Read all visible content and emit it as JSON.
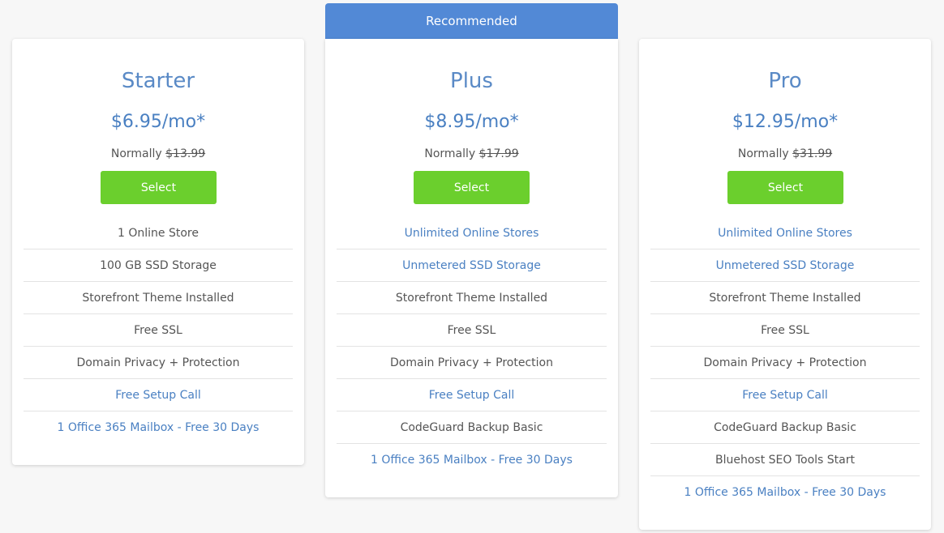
{
  "ribbon": {
    "label": "Recommended"
  },
  "colors": {
    "accent_blue": "#5289d6",
    "link_blue": "#4a80c2",
    "select_green": "#6bcf2d",
    "text_gray": "#555555"
  },
  "plans": [
    {
      "name": "Starter",
      "price": "$6.95/mo*",
      "normally_label": "Normally",
      "normally_price": "$13.99",
      "select_label": "Select",
      "features": [
        {
          "text": "1 Online Store",
          "highlight": false
        },
        {
          "text": "100 GB SSD Storage",
          "highlight": false
        },
        {
          "text": "Storefront Theme Installed",
          "highlight": false
        },
        {
          "text": "Free SSL",
          "highlight": false
        },
        {
          "text": "Domain Privacy + Protection",
          "highlight": false
        },
        {
          "text": "Free Setup Call",
          "highlight": true
        },
        {
          "text": "1 Office 365 Mailbox - Free 30 Days",
          "highlight": true
        }
      ]
    },
    {
      "name": "Plus",
      "price": "$8.95/mo*",
      "normally_label": "Normally",
      "normally_price": "$17.99",
      "select_label": "Select",
      "features": [
        {
          "text": "Unlimited Online Stores",
          "highlight": true
        },
        {
          "text": "Unmetered SSD Storage",
          "highlight": true
        },
        {
          "text": "Storefront Theme Installed",
          "highlight": false
        },
        {
          "text": "Free SSL",
          "highlight": false
        },
        {
          "text": "Domain Privacy + Protection",
          "highlight": false
        },
        {
          "text": "Free Setup Call",
          "highlight": true
        },
        {
          "text": "CodeGuard Backup Basic",
          "highlight": false
        },
        {
          "text": "1 Office 365 Mailbox - Free 30 Days",
          "highlight": true
        }
      ]
    },
    {
      "name": "Pro",
      "price": "$12.95/mo*",
      "normally_label": "Normally",
      "normally_price": "$31.99",
      "select_label": "Select",
      "features": [
        {
          "text": "Unlimited Online Stores",
          "highlight": true
        },
        {
          "text": "Unmetered SSD Storage",
          "highlight": true
        },
        {
          "text": "Storefront Theme Installed",
          "highlight": false
        },
        {
          "text": "Free SSL",
          "highlight": false
        },
        {
          "text": "Domain Privacy + Protection",
          "highlight": false
        },
        {
          "text": "Free Setup Call",
          "highlight": true
        },
        {
          "text": "CodeGuard Backup Basic",
          "highlight": false
        },
        {
          "text": "Bluehost SEO Tools Start",
          "highlight": false
        },
        {
          "text": "1 Office 365 Mailbox - Free 30 Days",
          "highlight": true
        }
      ]
    }
  ]
}
